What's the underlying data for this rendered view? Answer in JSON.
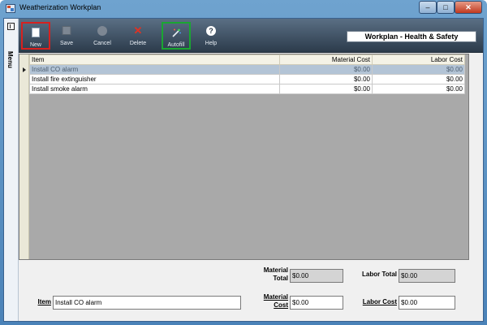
{
  "window": {
    "title": "Weatherization Workplan",
    "controls": {
      "minimize": "–",
      "maximize": "□",
      "close": "✕"
    }
  },
  "menu": {
    "label": "Menu"
  },
  "toolbar": {
    "new_label": "New",
    "save_label": "Save",
    "cancel_label": "Cancel",
    "delete_label": "Delete",
    "autofill_label": "Autofill",
    "help_label": "Help",
    "delete_glyph": "✕",
    "help_glyph": "?"
  },
  "panel": {
    "title": "Workplan - Health & Safety"
  },
  "grid": {
    "columns": [
      "Item",
      "Material Cost",
      "Labor Cost"
    ],
    "rows": [
      {
        "item": "Install CO alarm",
        "material_cost": "$0.00",
        "labor_cost": "$0.00",
        "selected": true
      },
      {
        "item": "Install fire extinguisher",
        "material_cost": "$0.00",
        "labor_cost": "$0.00"
      },
      {
        "item": "Install smoke alarm",
        "material_cost": "$0.00",
        "labor_cost": "$0.00"
      }
    ]
  },
  "totals": {
    "material_total_label_1": "Material",
    "material_total_label_2": "Total",
    "material_total_value": "$0.00",
    "labor_total_label": "Labor Total",
    "labor_total_value": "$0.00"
  },
  "editor": {
    "item_label": "Item",
    "item_value": "Install CO alarm",
    "material_cost_label_1": "Material",
    "material_cost_label_2": "Cost",
    "material_cost_value": "$0.00",
    "labor_cost_label": "Labor Cost",
    "labor_cost_value": "$0.00"
  },
  "colors": {
    "toolbar": "#3b4d60",
    "selected_row": "#b3c4d6",
    "new_highlight": "#d7211f",
    "autofill_highlight": "#1aa632"
  }
}
